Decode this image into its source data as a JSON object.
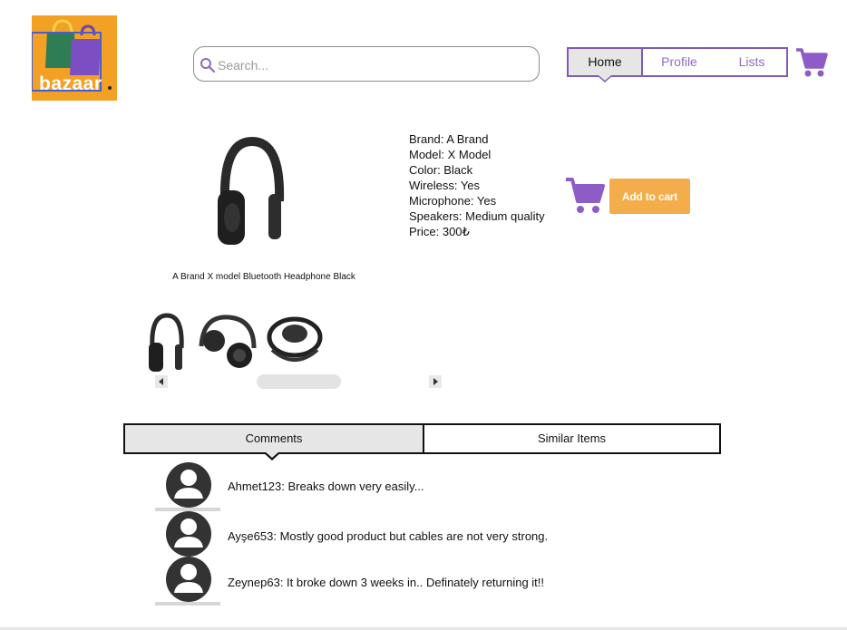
{
  "brand": {
    "logo_text": "bazaar",
    "colors": {
      "logo_bg": "#f2a124",
      "accent": "#7f5ab6",
      "button": "#f3ad4a"
    }
  },
  "search": {
    "placeholder": "Search..."
  },
  "nav": {
    "items": [
      {
        "label": "Home",
        "active": true
      },
      {
        "label": "Profile",
        "active": false
      },
      {
        "label": "Lists",
        "active": false
      }
    ],
    "cart_icon": "cart-icon"
  },
  "product": {
    "caption": "A Brand X model Bluetooth Headphone Black",
    "specs": [
      "Brand: A Brand",
      "Model: X Model",
      "Color: Black",
      "Wireless: Yes",
      "Microphone: Yes",
      "Speakers: Medium quality",
      "Price: 300₺"
    ],
    "add_to_cart_label": "Add to cart"
  },
  "tabs": [
    {
      "label": "Comments",
      "active": true
    },
    {
      "label": "Similar Items",
      "active": false
    }
  ],
  "comments": [
    "Ahmet123: Breaks down very easily...",
    "Ayşe653: Mostly good product but cables are not very strong.",
    "Zeynep63: It broke down 3 weeks in.. Definately returning it!!"
  ]
}
